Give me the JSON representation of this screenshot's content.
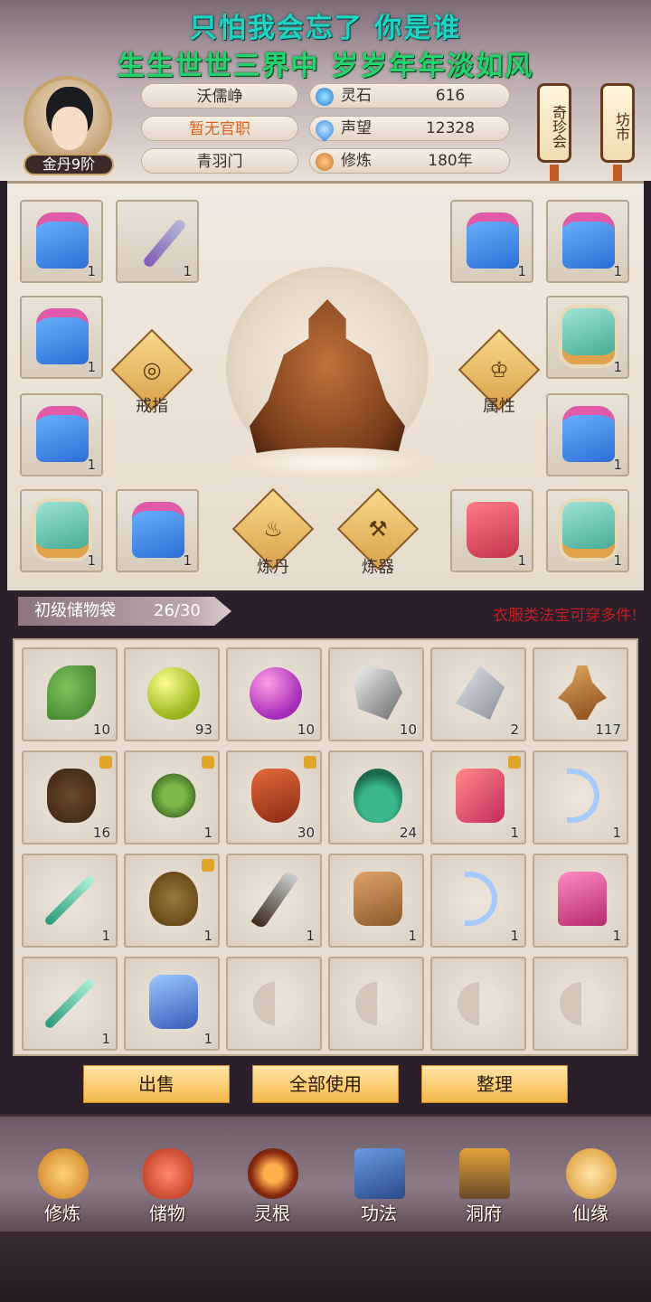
{
  "poem": {
    "line1": "只怕我会忘了 你是谁",
    "line2": "生生世世三界中 岁岁年年淡如风"
  },
  "profile": {
    "realm": "金丹9阶",
    "name": "沃儒峥",
    "title": "暂无官职",
    "sect": "青羽门",
    "stats": [
      {
        "label": "灵石",
        "value": "616",
        "icon": "spirit-stone-icon"
      },
      {
        "label": "声望",
        "value": "12328",
        "icon": "reputation-icon"
      },
      {
        "label": "修炼",
        "value": "180年",
        "icon": "cultivation-icon"
      }
    ]
  },
  "lanterns": {
    "left": "奇珍会",
    "right": "坊市"
  },
  "equipment": {
    "ring_label": "戒指",
    "attr_label": "属性",
    "alchemy_label": "炼丹",
    "forge_label": "炼器",
    "slots": [
      {
        "icon": "blue-robe-icon",
        "qty": "1"
      },
      {
        "icon": "purple-dagger-icon",
        "qty": "1"
      },
      {
        "icon": "blue-robe-icon",
        "qty": "1"
      },
      {
        "icon": "blue-robe-icon",
        "qty": "1"
      },
      {
        "icon": "blue-robe-icon",
        "qty": "1"
      },
      {
        "icon": "jade-vest-icon",
        "qty": "1"
      },
      {
        "icon": "blue-robe-icon",
        "qty": "1"
      },
      {
        "icon": "blue-robe-icon",
        "qty": "1"
      },
      {
        "icon": "jade-vest-icon",
        "qty": "1"
      },
      {
        "icon": "blue-robe-icon",
        "qty": "1"
      },
      {
        "icon": "red-boots-icon",
        "qty": "1"
      },
      {
        "icon": "jade-vest-icon",
        "qty": "1"
      }
    ]
  },
  "bag": {
    "name": "初级储物袋",
    "capacity": "26/30",
    "notice": "衣服类法宝可穿多件!",
    "items": [
      {
        "icon": "herb-leaf-icon",
        "qty": "10",
        "locked": false
      },
      {
        "icon": "yellow-orb-icon",
        "qty": "93",
        "locked": false
      },
      {
        "icon": "purple-orb-icon",
        "qty": "10",
        "locked": false
      },
      {
        "icon": "white-ore-icon",
        "qty": "10",
        "locked": false
      },
      {
        "icon": "silver-crystal-icon",
        "qty": "2",
        "locked": false
      },
      {
        "icon": "ginseng-root-icon",
        "qty": "117",
        "locked": false
      },
      {
        "icon": "tuber-icon",
        "qty": "16",
        "locked": true
      },
      {
        "icon": "flower-herb-icon",
        "qty": "1",
        "locked": true
      },
      {
        "icon": "red-pepper-icon",
        "qty": "30",
        "locked": true
      },
      {
        "icon": "green-gourd-icon",
        "qty": "24",
        "locked": false
      },
      {
        "icon": "scroll-treasure-icon",
        "qty": "1",
        "locked": true
      },
      {
        "icon": "ice-bow-icon",
        "qty": "1",
        "locked": false
      },
      {
        "icon": "jade-sword-icon",
        "qty": "1",
        "locked": false
      },
      {
        "icon": "treasure-pouch-icon",
        "qty": "1",
        "locked": true
      },
      {
        "icon": "broad-blade-icon",
        "qty": "1",
        "locked": false
      },
      {
        "icon": "leather-shoes-icon",
        "qty": "1",
        "locked": false
      },
      {
        "icon": "ice-bow-icon",
        "qty": "1",
        "locked": false
      },
      {
        "icon": "pink-armor-icon",
        "qty": "1",
        "locked": false
      },
      {
        "icon": "jade-sword-icon",
        "qty": "1",
        "locked": false
      },
      {
        "icon": "blue-shoes-icon",
        "qty": "1",
        "locked": false
      },
      {
        "icon": "empty-slot-icon",
        "qty": "",
        "locked": false
      },
      {
        "icon": "empty-slot-icon",
        "qty": "",
        "locked": false
      },
      {
        "icon": "empty-slot-icon",
        "qty": "",
        "locked": false
      },
      {
        "icon": "empty-slot-icon",
        "qty": "",
        "locked": false
      }
    ]
  },
  "actions": {
    "sell": "出售",
    "use_all": "全部使用",
    "sort": "整理"
  },
  "nav": [
    {
      "label": "修炼",
      "icon": "cultivate-icon",
      "color": "#e8a23a"
    },
    {
      "label": "储物",
      "icon": "storage-bag-icon",
      "color": "#e0543a"
    },
    {
      "label": "灵根",
      "icon": "spirit-root-icon",
      "color": "#b8402a"
    },
    {
      "label": "功法",
      "icon": "technique-book-icon",
      "color": "#3a6ab8"
    },
    {
      "label": "洞府",
      "icon": "cave-dwelling-icon",
      "color": "#8a5a2a"
    },
    {
      "label": "仙缘",
      "icon": "immortal-fate-icon",
      "color": "#e0a23a"
    }
  ],
  "colors": {
    "poem_line1": "#1fd4c4",
    "poem_line2": "#23d46e",
    "warning": "#c21f1f",
    "title_orange": "#d9631f"
  }
}
